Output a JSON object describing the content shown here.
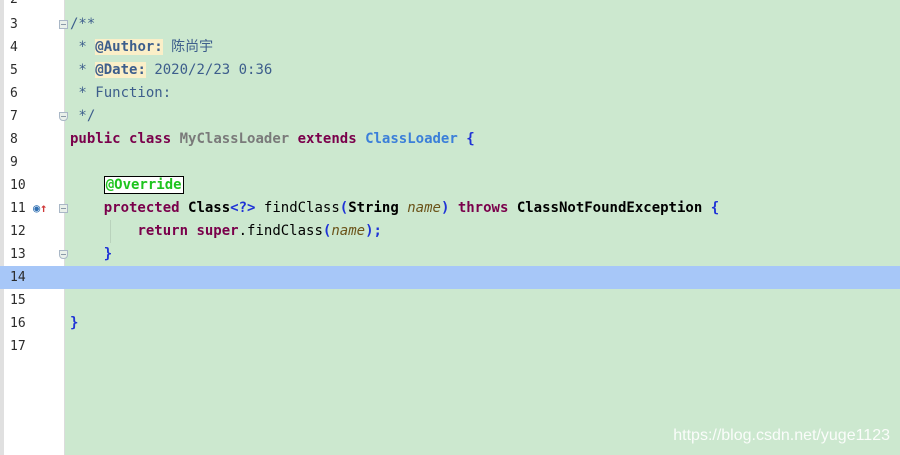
{
  "gutter": {
    "line_numbers": [
      "2",
      "3",
      "4",
      "5",
      "6",
      "7",
      "8",
      "9",
      "10",
      "11",
      "12",
      "13",
      "14",
      "15",
      "16",
      "17"
    ],
    "current_line": "14",
    "icons": {
      "breakpoint_marker": "override-method-icon",
      "override_arrow": "overrides-up-arrow-icon",
      "fold": "fold-icon"
    }
  },
  "code": {
    "l3": {
      "text": "/**"
    },
    "l4": {
      "prefix": " * ",
      "tag": "@Author:",
      "value": "陈尚宇"
    },
    "l5": {
      "prefix": " * ",
      "tag": "@Date:",
      "value": "2020/2/23 0:36"
    },
    "l6": {
      "text": " * Function:"
    },
    "l7": {
      "text": " */"
    },
    "l8": {
      "kw1": "public",
      "kw2": "class",
      "classname": "MyClassLoader",
      "kw3": "extends",
      "superclass": "ClassLoader",
      "brace": "{"
    },
    "l10": {
      "annotation": "@Override"
    },
    "l11": {
      "kw1": "protected",
      "type": "Class",
      "generic": "<?>",
      "method": "findClass",
      "lparen": "(",
      "ptype": "String",
      "pname": "name",
      "rparen": ")",
      "kw2": "throws",
      "exception": "ClassNotFoundException",
      "brace": "{"
    },
    "l12": {
      "kw1": "return",
      "kw2": "super",
      "call": ".findClass",
      "lparen": "(",
      "arg": "name",
      "tail": ");"
    },
    "l13": {
      "brace": "}"
    },
    "l16": {
      "brace": "}"
    }
  },
  "colors": {
    "editor_background": "#cce8cf",
    "current_line": "#a7c7f8",
    "keyword": "#7a004b",
    "doc_comment": "#3d5e8c",
    "annotation": "#1ec41e"
  },
  "watermark": "https://blog.csdn.net/yuge1123"
}
